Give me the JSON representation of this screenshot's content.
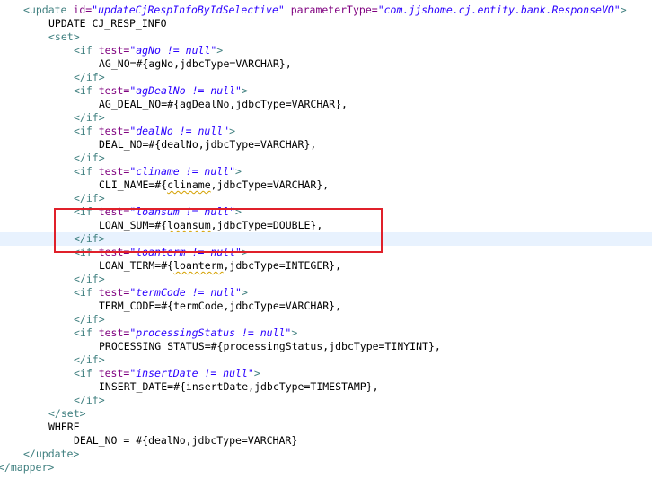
{
  "editor": {
    "current_line_index": 17,
    "highlight_color": "#e0202a",
    "lines": [
      {
        "indent": 4,
        "tokens": [
          {
            "t": "tag",
            "v": "<update "
          },
          {
            "t": "attr",
            "v": "id="
          },
          {
            "t": "str",
            "v": "\"updateCjRespInfoByIdSelective\""
          },
          {
            "t": "plain",
            "v": " "
          },
          {
            "t": "attr",
            "v": "parameterType="
          },
          {
            "t": "str",
            "v": "\"com.jjshome.cj.entity.bank.ResponseVO\""
          },
          {
            "t": "tag",
            "v": ">"
          }
        ]
      },
      {
        "indent": 8,
        "tokens": [
          {
            "t": "plain",
            "v": "UPDATE CJ_RESP_INFO"
          }
        ]
      },
      {
        "indent": 8,
        "tokens": [
          {
            "t": "tag",
            "v": "<set>"
          }
        ]
      },
      {
        "indent": 12,
        "tokens": [
          {
            "t": "tag",
            "v": "<if "
          },
          {
            "t": "attr",
            "v": "test="
          },
          {
            "t": "str",
            "v": "\"agNo != null\""
          },
          {
            "t": "tag",
            "v": ">"
          }
        ]
      },
      {
        "indent": 16,
        "tokens": [
          {
            "t": "plain",
            "v": "AG_NO=#{agNo,jdbcType=VARCHAR},"
          }
        ]
      },
      {
        "indent": 12,
        "tokens": [
          {
            "t": "tag",
            "v": "</if>"
          }
        ]
      },
      {
        "indent": 12,
        "tokens": [
          {
            "t": "tag",
            "v": "<if "
          },
          {
            "t": "attr",
            "v": "test="
          },
          {
            "t": "str",
            "v": "\"agDealNo != null\""
          },
          {
            "t": "tag",
            "v": ">"
          }
        ]
      },
      {
        "indent": 16,
        "tokens": [
          {
            "t": "plain",
            "v": "AG_DEAL_NO=#{agDealNo,jdbcType=VARCHAR},"
          }
        ]
      },
      {
        "indent": 12,
        "tokens": [
          {
            "t": "tag",
            "v": "</if>"
          }
        ]
      },
      {
        "indent": 12,
        "tokens": [
          {
            "t": "tag",
            "v": "<if "
          },
          {
            "t": "attr",
            "v": "test="
          },
          {
            "t": "str",
            "v": "\"dealNo != null\""
          },
          {
            "t": "tag",
            "v": ">"
          }
        ]
      },
      {
        "indent": 16,
        "tokens": [
          {
            "t": "plain",
            "v": "DEAL_NO=#{dealNo,jdbcType=VARCHAR},"
          }
        ]
      },
      {
        "indent": 12,
        "tokens": [
          {
            "t": "tag",
            "v": "</if>"
          }
        ]
      },
      {
        "indent": 12,
        "tokens": [
          {
            "t": "tag",
            "v": "<if "
          },
          {
            "t": "attr",
            "v": "test="
          },
          {
            "t": "str",
            "v": "\"cliname != null\""
          },
          {
            "t": "tag",
            "v": ">"
          }
        ]
      },
      {
        "indent": 16,
        "tokens": [
          {
            "t": "plain",
            "v": "CLI_NAME=#{"
          },
          {
            "t": "squig",
            "v": "cliname"
          },
          {
            "t": "plain",
            "v": ",jdbcType=VARCHAR},"
          }
        ]
      },
      {
        "indent": 12,
        "tokens": [
          {
            "t": "tag",
            "v": "</if>"
          }
        ]
      },
      {
        "indent": 12,
        "tokens": [
          {
            "t": "tag",
            "v": "<if "
          },
          {
            "t": "attr",
            "v": "test="
          },
          {
            "t": "str",
            "v": "\"loansum != null\""
          },
          {
            "t": "tag",
            "v": ">"
          }
        ]
      },
      {
        "indent": 16,
        "tokens": [
          {
            "t": "plain",
            "v": "LOAN_SUM=#{"
          },
          {
            "t": "squig",
            "v": "loansum"
          },
          {
            "t": "plain",
            "v": ",jdbcType=DOUBLE},"
          }
        ]
      },
      {
        "indent": 12,
        "tokens": [
          {
            "t": "tag",
            "v": "</if>"
          }
        ]
      },
      {
        "indent": 12,
        "tokens": [
          {
            "t": "tag",
            "v": "<if "
          },
          {
            "t": "attr",
            "v": "test="
          },
          {
            "t": "str",
            "v": "\"loanterm != null\""
          },
          {
            "t": "tag",
            "v": ">"
          }
        ]
      },
      {
        "indent": 16,
        "tokens": [
          {
            "t": "plain",
            "v": "LOAN_TERM=#{"
          },
          {
            "t": "squig",
            "v": "loanterm"
          },
          {
            "t": "plain",
            "v": ",jdbcType=INTEGER},"
          }
        ]
      },
      {
        "indent": 12,
        "tokens": [
          {
            "t": "tag",
            "v": "</if>"
          }
        ]
      },
      {
        "indent": 12,
        "tokens": [
          {
            "t": "tag",
            "v": "<if "
          },
          {
            "t": "attr",
            "v": "test="
          },
          {
            "t": "str",
            "v": "\"termCode != null\""
          },
          {
            "t": "tag",
            "v": ">"
          }
        ]
      },
      {
        "indent": 16,
        "tokens": [
          {
            "t": "plain",
            "v": "TERM_CODE=#{termCode,jdbcType=VARCHAR},"
          }
        ]
      },
      {
        "indent": 12,
        "tokens": [
          {
            "t": "tag",
            "v": "</if>"
          }
        ]
      },
      {
        "indent": 12,
        "tokens": [
          {
            "t": "tag",
            "v": "<if "
          },
          {
            "t": "attr",
            "v": "test="
          },
          {
            "t": "str",
            "v": "\"processingStatus != null\""
          },
          {
            "t": "tag",
            "v": ">"
          }
        ]
      },
      {
        "indent": 16,
        "tokens": [
          {
            "t": "plain",
            "v": "PROCESSING_STATUS=#{processingStatus,jdbcType=TINYINT},"
          }
        ]
      },
      {
        "indent": 12,
        "tokens": [
          {
            "t": "tag",
            "v": "</if>"
          }
        ]
      },
      {
        "indent": 12,
        "tokens": [
          {
            "t": "tag",
            "v": "<if "
          },
          {
            "t": "attr",
            "v": "test="
          },
          {
            "t": "str",
            "v": "\"insertDate != null\""
          },
          {
            "t": "tag",
            "v": ">"
          }
        ]
      },
      {
        "indent": 16,
        "tokens": [
          {
            "t": "plain",
            "v": "INSERT_DATE=#{insertDate,jdbcType=TIMESTAMP},"
          }
        ]
      },
      {
        "indent": 12,
        "tokens": [
          {
            "t": "tag",
            "v": "</if>"
          }
        ]
      },
      {
        "indent": 8,
        "tokens": [
          {
            "t": "tag",
            "v": "</set>"
          }
        ]
      },
      {
        "indent": 8,
        "tokens": [
          {
            "t": "plain",
            "v": "WHERE"
          }
        ]
      },
      {
        "indent": 12,
        "tokens": [
          {
            "t": "plain",
            "v": "DEAL_NO = #{dealNo,jdbcType=VARCHAR}"
          }
        ]
      },
      {
        "indent": 4,
        "tokens": [
          {
            "t": "tag",
            "v": "</update>"
          }
        ]
      },
      {
        "indent": 0,
        "tokens": [
          {
            "t": "tag",
            "v": "</mapper>"
          }
        ]
      }
    ]
  }
}
